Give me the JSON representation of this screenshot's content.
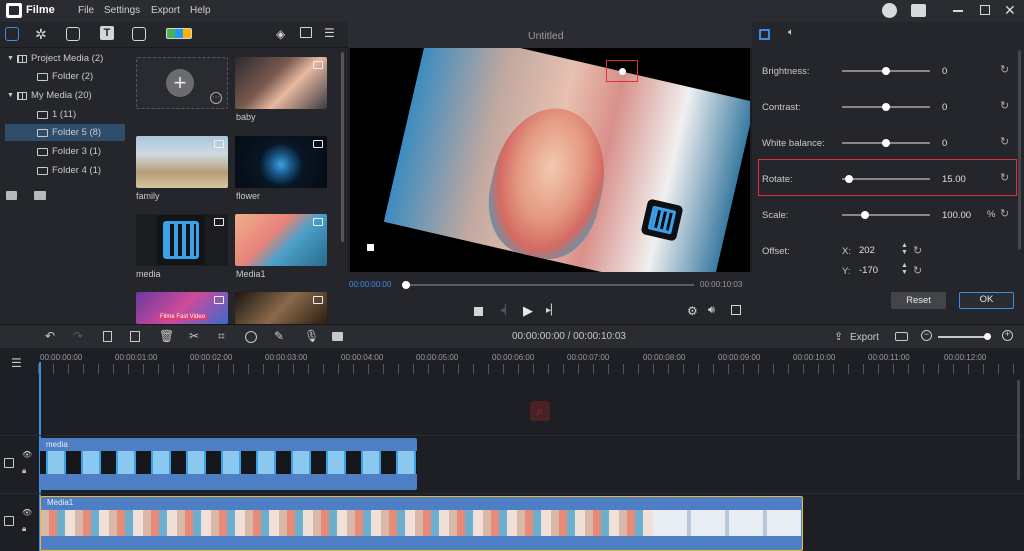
{
  "app": {
    "name": "Filme"
  },
  "menu": [
    "File",
    "Settings",
    "Export",
    "Help"
  ],
  "tree": {
    "items": [
      {
        "label": "Project Media (2)",
        "level": 0,
        "expanded": true
      },
      {
        "label": "Folder (2)",
        "level": 1
      },
      {
        "label": "My Media (20)",
        "level": 0,
        "expanded": true
      },
      {
        "label": "1 (11)",
        "level": 1
      },
      {
        "label": "Folder 5 (8)",
        "level": 1,
        "selected": true
      },
      {
        "label": "Folder 3 (1)",
        "level": 1
      },
      {
        "label": "Folder 4 (1)",
        "level": 1
      }
    ]
  },
  "media": {
    "items": [
      {
        "label": "",
        "type": "add"
      },
      {
        "label": "baby",
        "type": "image"
      },
      {
        "label": "family",
        "type": "image"
      },
      {
        "label": "flower",
        "type": "image"
      },
      {
        "label": "media",
        "type": "image"
      },
      {
        "label": "Media1",
        "type": "video"
      },
      {
        "label": "",
        "type": "video",
        "overlay": "Filme Fast Video"
      },
      {
        "label": "",
        "type": "image"
      }
    ]
  },
  "preview": {
    "title": "Untitled",
    "current": "00:00:00:00",
    "total": "00:00:10:03",
    "progress": 0.0
  },
  "props": {
    "brightness": {
      "label": "Brightness:",
      "value": "0",
      "pos": 0.5
    },
    "contrast": {
      "label": "Contrast:",
      "value": "0",
      "pos": 0.5
    },
    "white_balance": {
      "label": "White balance:",
      "value": "0",
      "pos": 0.5
    },
    "rotate": {
      "label": "Rotate:",
      "value": "15.00",
      "pos": 0.08
    },
    "scale": {
      "label": "Scale:",
      "value": "100.00",
      "unit": "%",
      "pos": 0.25
    },
    "offset": {
      "label": "Offset:",
      "x_label": "X:",
      "x_value": "202",
      "y_label": "Y:",
      "y_value": "-170"
    },
    "reset_label": "Reset",
    "ok_label": "OK"
  },
  "timeline": {
    "export_label": "Export",
    "timecode": "00:00:00:00 / 00:00:10:03",
    "ticks": [
      "00:00:00:00",
      "00:00:01:00",
      "00:00:02:00",
      "00:00:03:00",
      "00:00:04:00",
      "00:00:05:00",
      "00:00:06:00",
      "00:00:07:00",
      "00:00:08:00",
      "00:00:09:00",
      "00:00:10:00",
      "00:00:11:00",
      "00:00:12:00"
    ],
    "clips": [
      {
        "label": "media"
      },
      {
        "label": "Media1"
      }
    ]
  },
  "colors": {
    "accent": "#3a8ee6",
    "clip": "#4e7fc4",
    "selection": "#e0303a",
    "clip_border": "#e8b83a"
  }
}
